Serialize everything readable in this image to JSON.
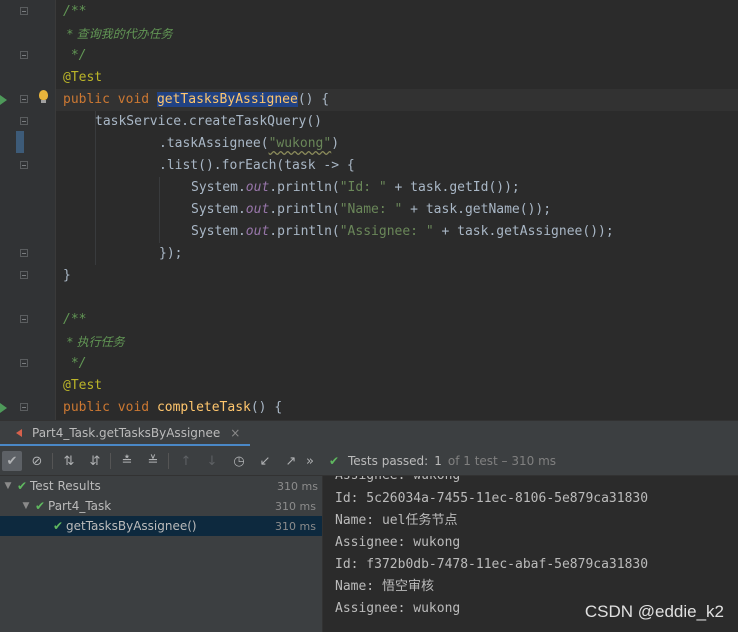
{
  "editor": {
    "code": {
      "l1_open": "/**",
      "l2_comment": " * 查询我的代办任务",
      "l3_close": " */",
      "l4_annotation": "@Test",
      "l5_public": "public",
      "l5_void": "void",
      "l5_method": "getTasksByAssignee",
      "l5_rest": "() {",
      "l6": "taskService.createTaskQuery()",
      "l7_pre": ".taskAssignee(",
      "l7_str": "\"wukong\"",
      "l7_post": ")",
      "l8_pre": ".list().forEach(task ",
      "l8_arrow": "->",
      "l8_post": " {",
      "l9_a": "System.",
      "l9_out": "out",
      "l9_b": ".println(",
      "l9_str": "\"Id: \"",
      "l9_c": " + task.getId());",
      "l10_str": "\"Name: \"",
      "l10_c": " + task.getName());",
      "l11_str": "\"Assignee: \"",
      "l11_c": " + task.getAssignee());",
      "l12": "});",
      "l13": "}",
      "l15_open": "/**",
      "l16_comment": " * 执行任务",
      "l17_close": " */",
      "l18_annotation": "@Test",
      "l19_public": "public",
      "l19_void": "void",
      "l19_method": "completeTask",
      "l19_rest": "() {"
    }
  },
  "run_panel": {
    "tab_label": "Part4_Task.getTasksByAssignee",
    "tab_close": "×",
    "status": {
      "passed_label": "Tests passed:",
      "passed_count": "1",
      "detail": "of 1 test – 310 ms"
    },
    "tree": [
      {
        "label": "Test Results",
        "time": "310 ms"
      },
      {
        "label": "Part4_Task",
        "time": "310 ms"
      },
      {
        "label": "getTasksByAssignee()",
        "time": "310 ms"
      }
    ],
    "console": [
      "Assignee: wukong",
      "Id: 5c26034a-7455-11ec-8106-5e879ca31830",
      "Name: uel任务节点",
      "Assignee: wukong",
      "Id: f372b0db-7478-11ec-abaf-5e879ca31830",
      "Name: 悟空审核",
      "Assignee: wukong"
    ]
  },
  "watermark": "CSDN @eddie_k2",
  "colors": {
    "accent": "#4a88c7",
    "pass": "#5fb85f",
    "selection": "#214283"
  }
}
